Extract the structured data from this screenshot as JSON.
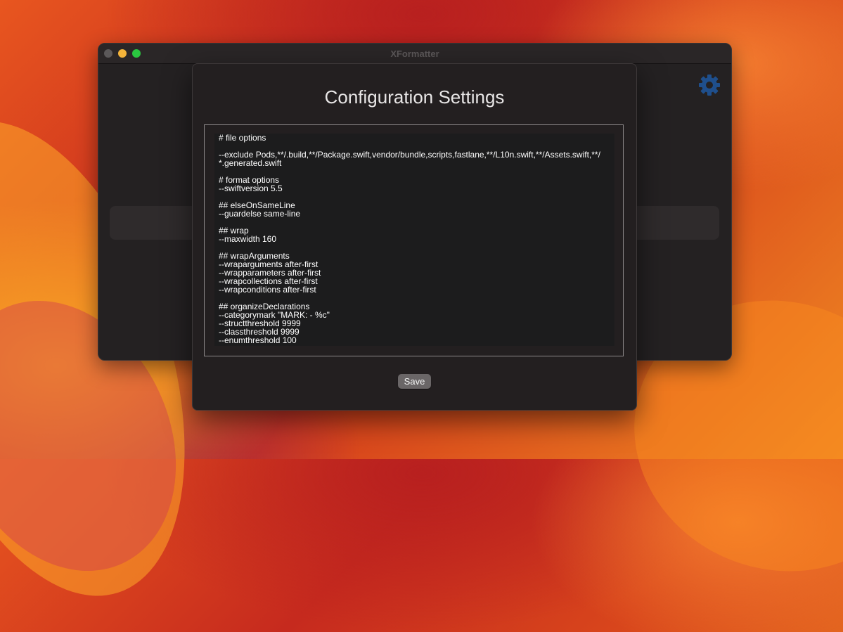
{
  "window": {
    "title": "XFormatter"
  },
  "sheet": {
    "title": "Configuration Settings",
    "editor_lines": [
      "# file options",
      "",
      "--exclude Pods,**/.build,**/Package.swift,vendor/bundle,scripts,fastlane,**/L10n.swift,**/Assets.swift,**/",
      "*.generated.swift",
      "",
      "# format options",
      "--swiftversion 5.5",
      "",
      "## elseOnSameLine",
      "--guardelse same-line",
      "",
      "## wrap",
      "--maxwidth 160",
      "",
      "## wrapArguments",
      "--wraparguments after-first",
      "--wrapparameters after-first",
      "--wrapcollections after-first",
      "--wrapconditions after-first",
      "",
      "## organizeDeclarations",
      "--categorymark \"MARK: - %c\"",
      "--structthreshold 9999",
      "--classthreshold 9999",
      "--enumthreshold 100"
    ],
    "save_label": "Save"
  },
  "icons": {
    "settings": "gear-icon",
    "close": "close-window-icon",
    "minimize": "minimize-window-icon",
    "maximize": "maximize-window-icon"
  },
  "colors": {
    "accent_gear": "#1f4f8c",
    "traffic_close": "#5b5859",
    "traffic_minimize": "#f4b33a",
    "traffic_maximize": "#2ac840"
  }
}
